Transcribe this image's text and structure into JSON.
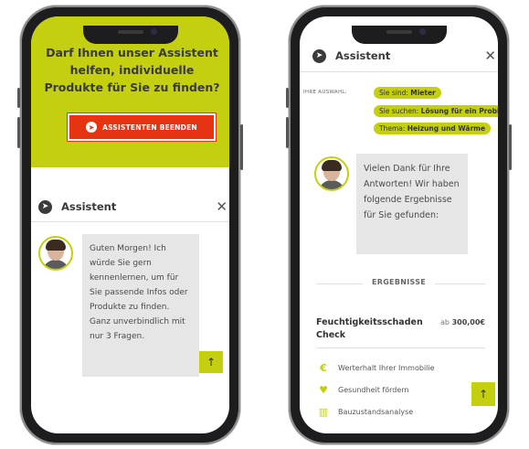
{
  "left_screen": {
    "hero_title": "Darf Ihnen unser Assistent helfen, individuelle Produkte für Sie zu finden?",
    "end_button_label": "ASSISTENTEN BEENDEN",
    "header_title": "Assistent",
    "close_symbol": "✕",
    "chat_message": "Guten Morgen! Ich würde Sie gern kennenlernen, um für Sie passende Infos oder Produkte zu finden. Ganz unverbindlich mit nur 3 Fragen.",
    "scroll_up_symbol": "↑"
  },
  "right_screen": {
    "header_title": "Assistent",
    "close_symbol": "✕",
    "selection_label": "IHRE AUSWAHL:",
    "chips": [
      {
        "prefix": "Sie sind:",
        "value": "Mieter"
      },
      {
        "prefix": "Sie suchen:",
        "value": "Lösung für ein Proble"
      },
      {
        "prefix": "Thema:",
        "value": "Heizung und Wärme"
      }
    ],
    "chat_message": "Vielen Dank für Ihre Antworten! Wir haben folgende Ergebnisse für Sie gefunden:",
    "results_label": "ERGEBNISSE",
    "result_title": "Feuchtigkeitsschaden Check",
    "result_price_prefix": "ab",
    "result_price": "300,00€",
    "features": [
      {
        "icon": "euro-icon",
        "glyph": "€",
        "label": "Werterhalt Ihrer Immobilie"
      },
      {
        "icon": "heart-icon",
        "glyph": "♥",
        "label": "Gesundheit fördern"
      },
      {
        "icon": "building-chart-icon",
        "glyph": "▥",
        "label": "Bauzustandsanalyse"
      }
    ],
    "scroll_up_symbol": "↑"
  },
  "colors": {
    "accent": "#c3cf0f",
    "button_red": "#e63312",
    "phone_frame": "#1d1d1f",
    "bubble_bg": "#e6e6e6"
  }
}
